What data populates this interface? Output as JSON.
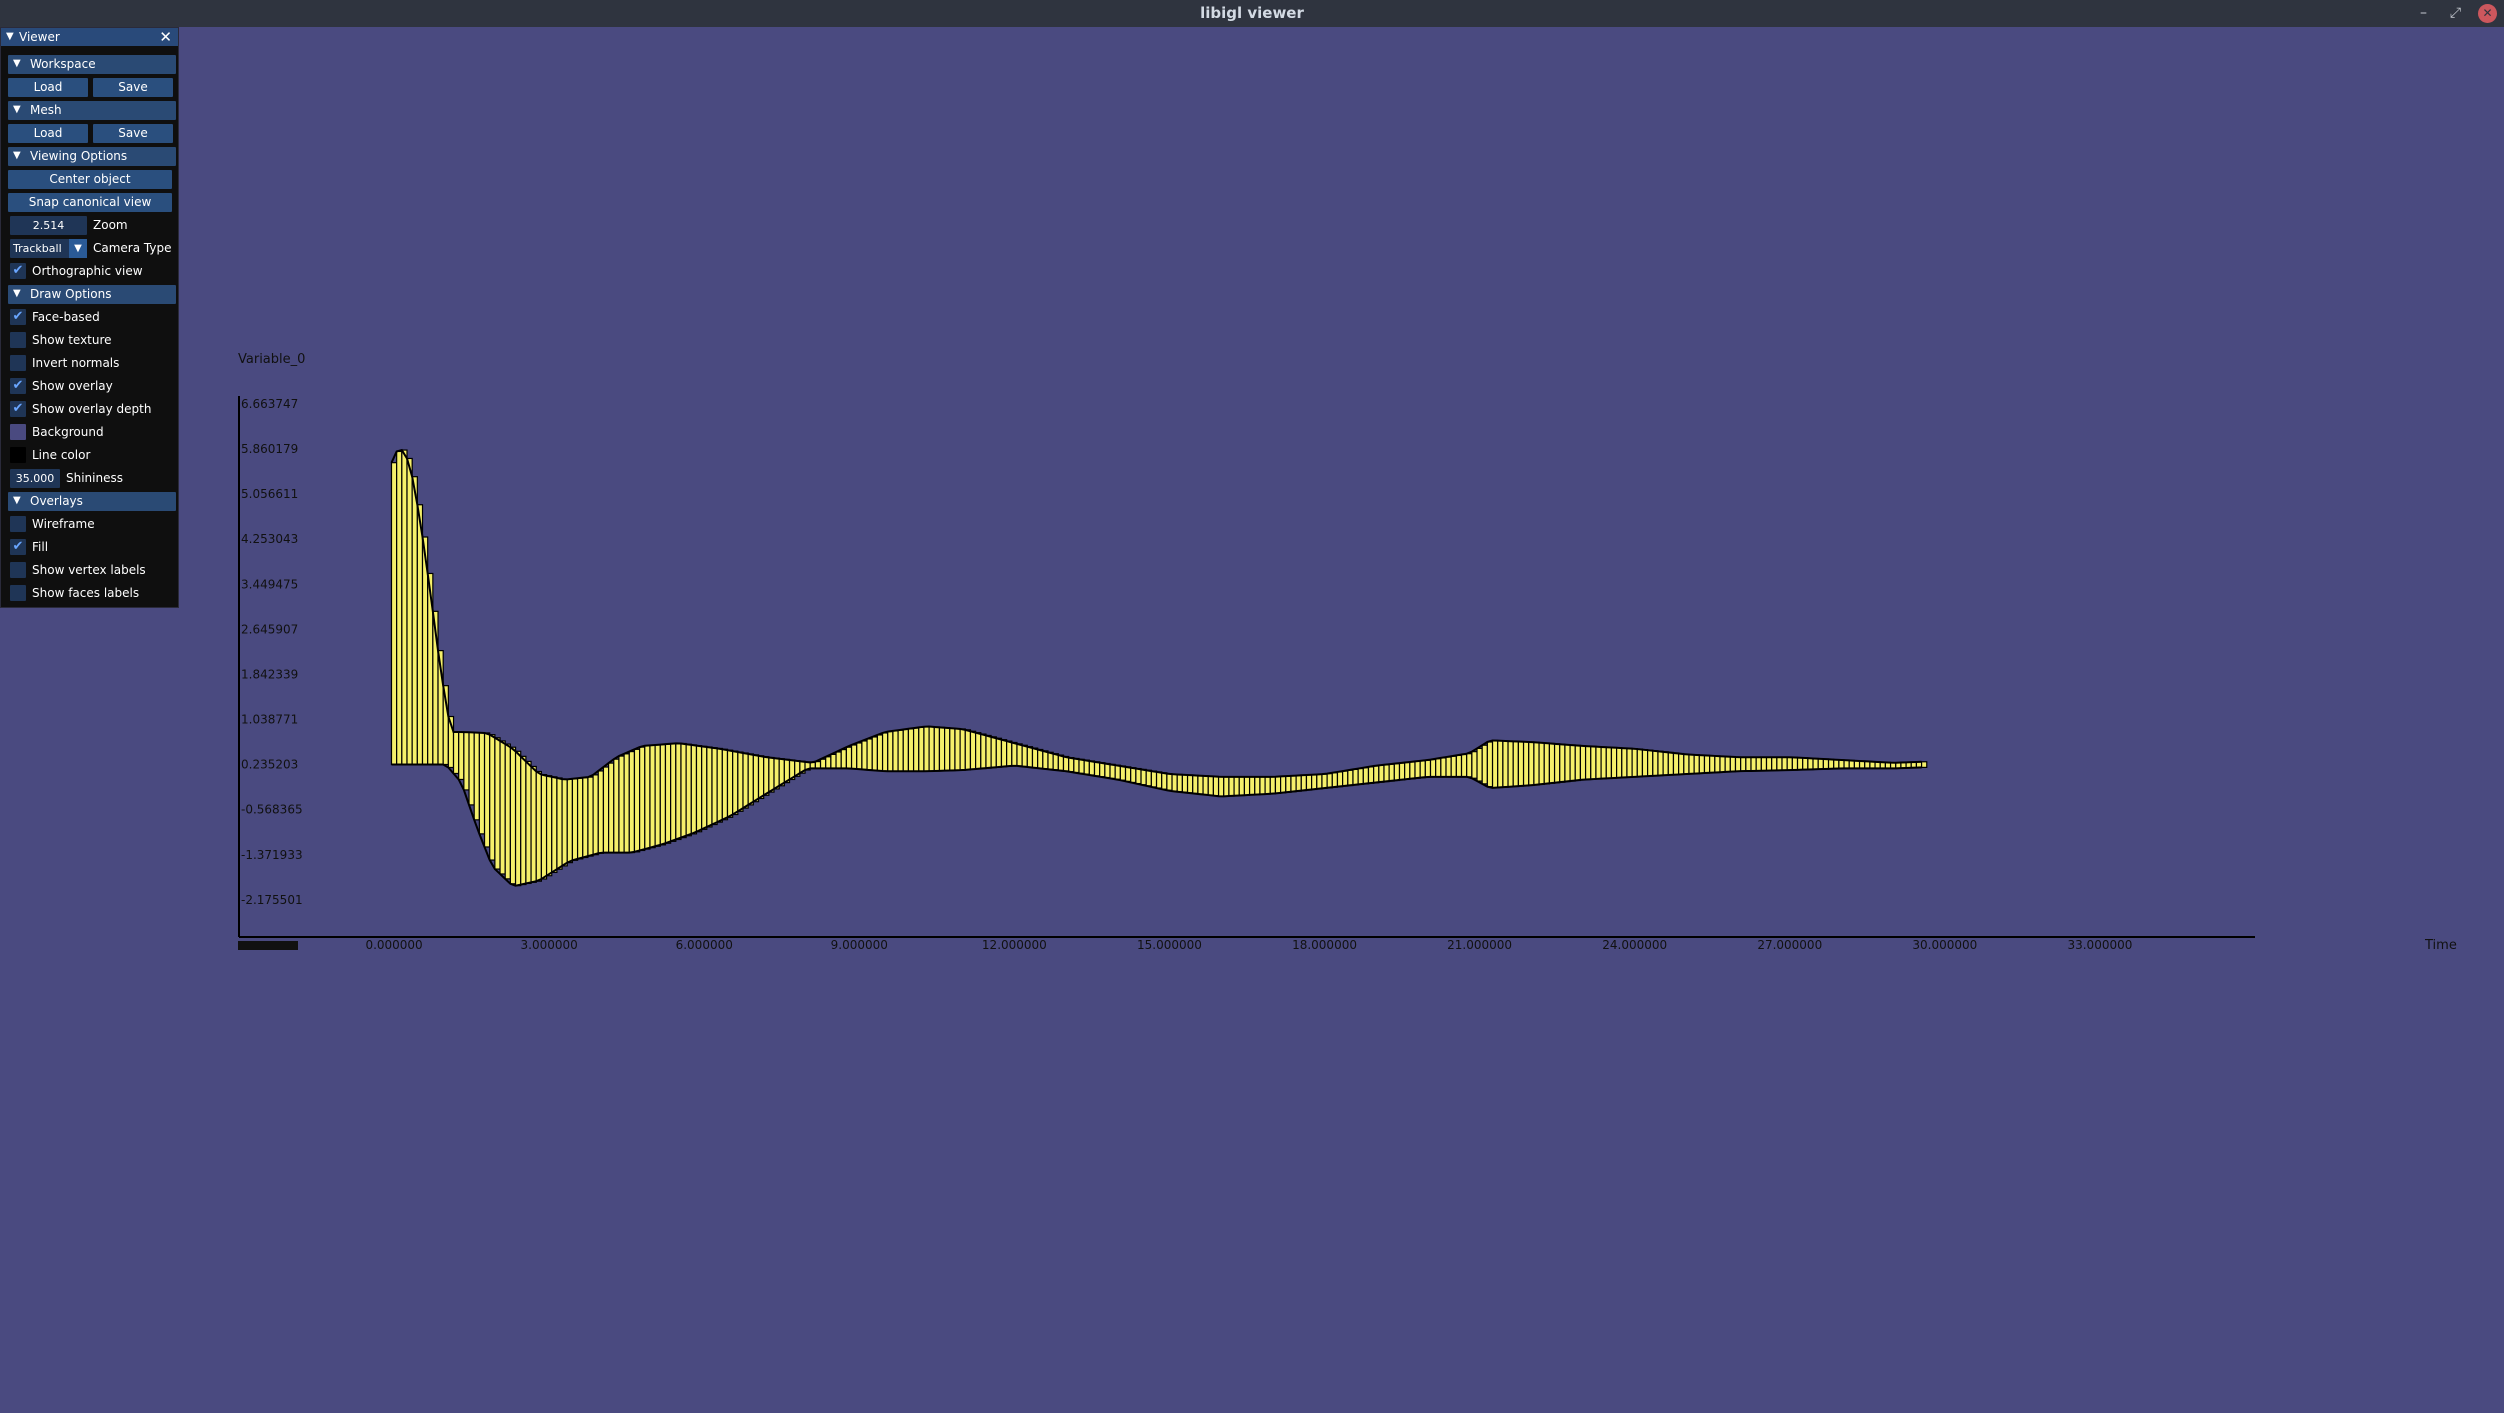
{
  "window": {
    "title": "libigl viewer",
    "min_icon": "–",
    "max_icon": "⤢",
    "close_icon": "✕"
  },
  "panel": {
    "title": "Viewer",
    "close_icon": "✕",
    "workspace": {
      "header": "Workspace",
      "load": "Load",
      "save": "Save"
    },
    "mesh": {
      "header": "Mesh",
      "load": "Load",
      "save": "Save"
    },
    "viewing_options": {
      "header": "Viewing Options",
      "center_object": "Center object",
      "snap_canonical": "Snap canonical view",
      "zoom_value": "2.514",
      "zoom_label": "Zoom",
      "camera_value": "Trackball",
      "camera_label": "Camera Type",
      "ortho_label": "Orthographic view",
      "ortho_checked": true
    },
    "draw_options": {
      "header": "Draw Options",
      "face_based": "Face-based",
      "face_based_checked": true,
      "show_texture": "Show texture",
      "show_texture_checked": false,
      "invert_normals": "Invert normals",
      "invert_normals_checked": false,
      "show_overlay": "Show overlay",
      "show_overlay_checked": true,
      "show_overlay_depth": "Show overlay depth",
      "show_overlay_depth_checked": true,
      "background_label": "Background",
      "background_color": "#4a4a80",
      "line_color_label": "Line color",
      "line_color": "#000000",
      "shininess_value": "35.000",
      "shininess_label": "Shininess"
    },
    "overlays": {
      "header": "Overlays",
      "wireframe": "Wireframe",
      "wireframe_checked": false,
      "fill": "Fill",
      "fill_checked": true,
      "vertex_labels": "Show vertex labels",
      "vertex_labels_checked": false,
      "face_labels": "Show faces labels",
      "face_labels_checked": false
    }
  },
  "chart_data": {
    "type": "area",
    "ylabel": "Variable_0",
    "xlabel": "Time",
    "y_ticks": [
      "6.663747",
      "5.860179",
      "5.056611",
      "4.253043",
      "3.449475",
      "2.645907",
      "1.842339",
      "1.038771",
      "0.235203",
      "-0.568365",
      "-1.371933",
      "-2.175501"
    ],
    "x_ticks": [
      "0.000000",
      "3.000000",
      "6.000000",
      "9.000000",
      "12.000000",
      "15.000000",
      "18.000000",
      "21.000000",
      "24.000000",
      "27.000000",
      "30.000000",
      "33.000000"
    ],
    "xlim": [
      -3,
      36
    ],
    "ylim": [
      -2.7,
      7.2
    ],
    "fill_color": "#f5f06a",
    "series": [
      {
        "values": [
          [
            -0.05,
            5.6
          ],
          [
            0.1,
            5.9
          ],
          [
            0.3,
            5.6
          ],
          [
            0.5,
            4.6
          ],
          [
            0.7,
            3.3
          ],
          [
            0.9,
            1.9
          ],
          [
            1.1,
            0.8
          ],
          [
            1.3,
            0.8
          ],
          [
            1.8,
            0.78
          ],
          [
            2.3,
            0.5
          ],
          [
            2.8,
            0.05
          ],
          [
            3.3,
            -0.05
          ],
          [
            3.8,
            0.0
          ],
          [
            4.3,
            0.35
          ],
          [
            4.8,
            0.55
          ],
          [
            5.5,
            0.6
          ],
          [
            6.3,
            0.5
          ],
          [
            7.2,
            0.35
          ],
          [
            8.1,
            0.25
          ],
          [
            8.8,
            0.55
          ],
          [
            9.5,
            0.8
          ],
          [
            10.3,
            0.9
          ],
          [
            11.0,
            0.85
          ],
          [
            12.0,
            0.6
          ],
          [
            13.0,
            0.35
          ],
          [
            14.0,
            0.2
          ],
          [
            15.0,
            0.05
          ],
          [
            16.0,
            0.0
          ],
          [
            17.0,
            0.0
          ],
          [
            18.0,
            0.05
          ],
          [
            19.0,
            0.2
          ],
          [
            20.0,
            0.3
          ],
          [
            20.8,
            0.42
          ],
          [
            21.2,
            0.65
          ],
          [
            22.0,
            0.62
          ],
          [
            23.0,
            0.55
          ],
          [
            24.0,
            0.5
          ],
          [
            25.0,
            0.4
          ],
          [
            26.0,
            0.35
          ],
          [
            27.0,
            0.35
          ],
          [
            28.0,
            0.3
          ],
          [
            29.0,
            0.25
          ],
          [
            29.6,
            0.27
          ]
        ],
        "lower": [
          [
            -0.05,
            0.22
          ],
          [
            1.0,
            0.22
          ],
          [
            1.3,
            -0.1
          ],
          [
            1.6,
            -0.9
          ],
          [
            1.9,
            -1.6
          ],
          [
            2.3,
            -1.95
          ],
          [
            2.8,
            -1.85
          ],
          [
            3.4,
            -1.5
          ],
          [
            4.0,
            -1.35
          ],
          [
            4.6,
            -1.35
          ],
          [
            5.2,
            -1.2
          ],
          [
            5.8,
            -1.0
          ],
          [
            6.5,
            -0.7
          ],
          [
            7.2,
            -0.3
          ],
          [
            8.0,
            0.15
          ],
          [
            8.8,
            0.15
          ],
          [
            9.5,
            0.1
          ],
          [
            10.3,
            0.1
          ],
          [
            11.0,
            0.12
          ],
          [
            12.0,
            0.2
          ],
          [
            13.0,
            0.1
          ],
          [
            14.0,
            -0.05
          ],
          [
            15.0,
            -0.25
          ],
          [
            16.0,
            -0.35
          ],
          [
            17.0,
            -0.3
          ],
          [
            18.0,
            -0.2
          ],
          [
            19.0,
            -0.1
          ],
          [
            20.0,
            0.0
          ],
          [
            20.8,
            0.0
          ],
          [
            21.2,
            -0.2
          ],
          [
            22.0,
            -0.15
          ],
          [
            23.0,
            -0.05
          ],
          [
            24.0,
            0.0
          ],
          [
            25.0,
            0.05
          ],
          [
            26.0,
            0.1
          ],
          [
            27.0,
            0.12
          ],
          [
            28.0,
            0.15
          ],
          [
            29.0,
            0.15
          ],
          [
            29.6,
            0.17
          ]
        ]
      }
    ]
  }
}
